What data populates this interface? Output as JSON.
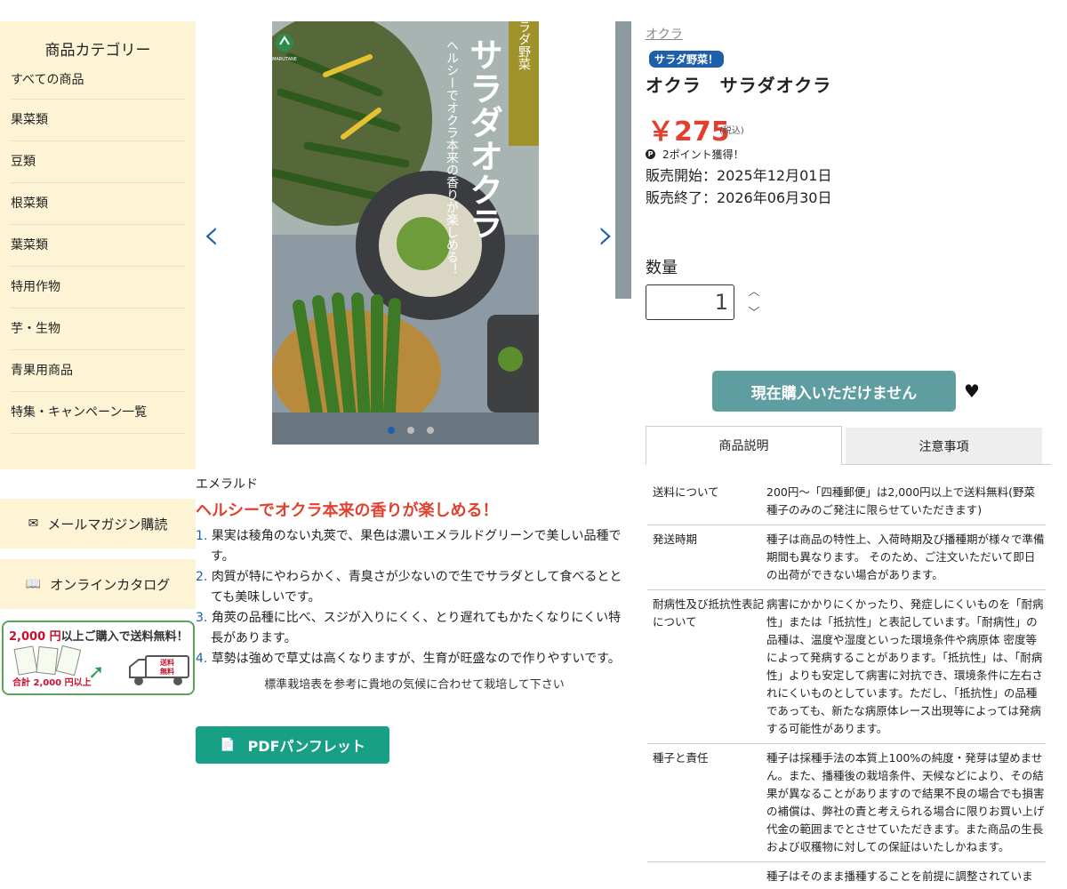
{
  "sidebar": {
    "title": "商品カテゴリー",
    "items": [
      "すべての商品",
      "果菜類",
      "豆類",
      "根菜類",
      "葉菜類",
      "特用作物",
      "芋・生物",
      "青果用商品",
      "特集・キャンペーン一覧"
    ],
    "mail_label": "メールマガジン購読",
    "catalog_label": "オンラインカタログ",
    "banner": {
      "amount": "2,000 円",
      "text": "以上ご購入で送料無料！",
      "sub": "合計 2,000 円以上",
      "truck_text_1": "送料",
      "truck_text_2": "無料"
    }
  },
  "product": {
    "breadcrumb": "オクラ",
    "badge": "サラダ野菜！",
    "title": "オクラ　サラダオクラ",
    "price": "￥275",
    "tax": "(税込)",
    "points": "2ポイント獲得！",
    "sale_start": "販売開始：2025年12月01日",
    "sale_end": "販売終了：2026年06月30日",
    "qty_label": "数量",
    "qty_value": "1",
    "buy_label": "現在購入いただけません",
    "package": {
      "brand": "MARUTANE",
      "tag": "サラダ野菜",
      "name": "サラダオクラ",
      "catch": "ヘルシーでオクラ本来の香りが楽しめる！"
    }
  },
  "description": {
    "variety": "エメラルド",
    "catch": "ヘルシーでオクラ本来の香りが楽しめる！",
    "points": [
      "果実は稜角のない丸莢で、果色は濃いエメラルドグリーンで美しい品種です。",
      "肉質が特にやわらかく、青臭さが少ないので生でサラダとして食べるととても美味しいです。",
      "角莢の品種に比べ、スジが入りにくく、とり遅れてもかたくなりにくい特長があります。",
      "草勢は強めで草丈は高くなりますが、生育が旺盛なので作りやすいです。"
    ],
    "note": "標準栽培表を参考に貴地の気候に合わせて栽培して下さい",
    "pdf_label": "PDFパンフレット"
  },
  "tabs": [
    "商品説明",
    "注意事項"
  ],
  "info_rows": [
    {
      "key": "送料について",
      "value": "200円〜「四種郵便」は2,000円以上で送料無料(野菜種子のみのご発注に限らせていただきます)"
    },
    {
      "key": "発送時期",
      "value": "種子は商品の特性上、入荷時期及び播種期が様々で準備期間も異なります。 そのため、ご注文いただいて即日の出荷ができない場合があります。"
    },
    {
      "key": "耐病性及び抵抗性表記について",
      "value": "病害にかかりにくかったり、発症しにくいものを「耐病性」または「抵抗性」と表記しています。「耐病性」の品種は、温度や湿度といった環境条件や病原体 密度等によって発病することがあります。「抵抗性」は、「耐病性」よりも安定して病害に対抗でき、環境条件に左右されにくいものとしています。ただし、「抵抗性」の品種であっても、新たな病原体レース出現等によっては発病する可能性があります。"
    },
    {
      "key": "種子と責任",
      "value": "種子は採種手法の本質上100%の純度・発芽は望めません。また、播種後の栽培条件、天候などにより、その結果が異なることがありますので結果不良の場合でも損害の補償は、弊社の責と考えられる場合に限りお買い上げ代金の範囲までとさせていただきます。また商品の生長および収穫物に対しての保証はいたしかねます。"
    },
    {
      "key": "",
      "value": "種子はそのまま播種することを前提に調整されていま"
    }
  ]
}
